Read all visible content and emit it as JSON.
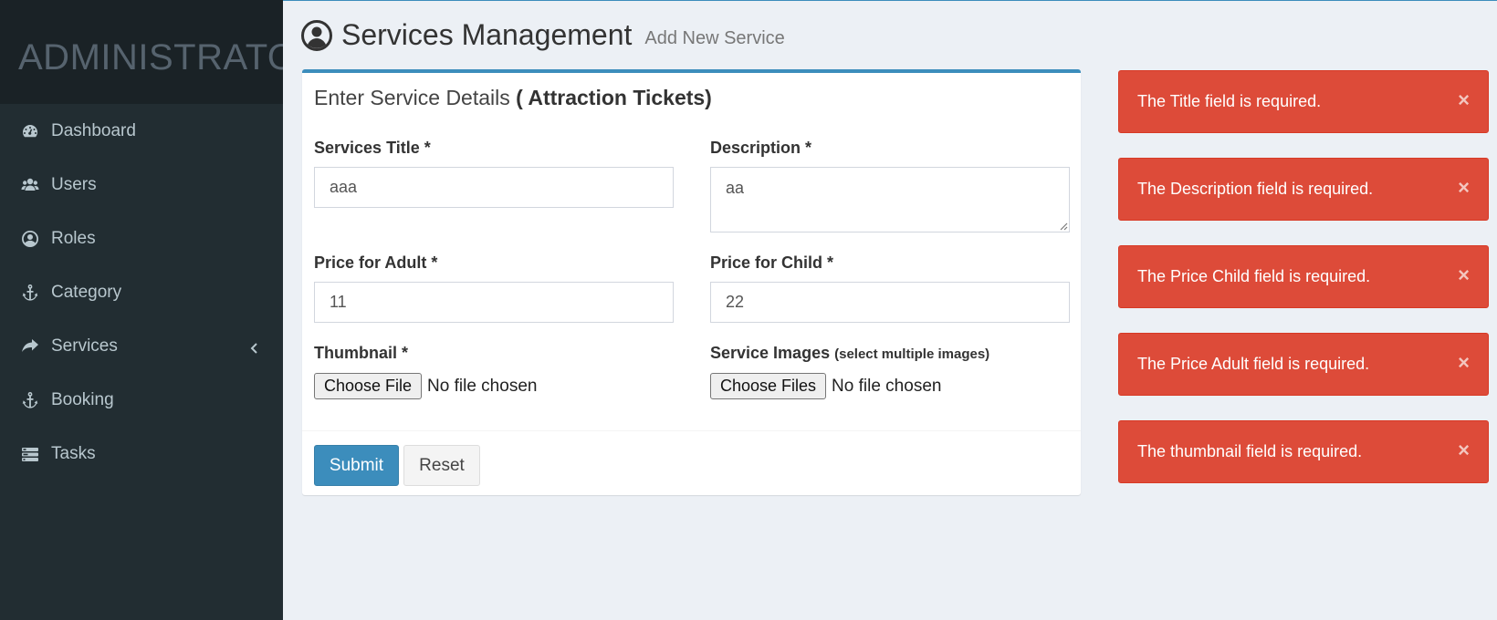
{
  "sidebar": {
    "logo_text": "ADMINISTRATOR",
    "items": [
      {
        "label": "Dashboard",
        "icon": "dashboard-icon"
      },
      {
        "label": "Users",
        "icon": "users-icon"
      },
      {
        "label": "Roles",
        "icon": "user-circle-icon"
      },
      {
        "label": "Category",
        "icon": "anchor-icon"
      },
      {
        "label": "Services",
        "icon": "share-icon",
        "has_submenu": true
      },
      {
        "label": "Booking",
        "icon": "anchor-icon"
      },
      {
        "label": "Tasks",
        "icon": "tasks-icon"
      }
    ]
  },
  "header": {
    "title": "Services Management",
    "subtitle": "Add New Service",
    "icon": "user-circle-icon"
  },
  "form": {
    "box_title_prefix": "Enter Service Details",
    "box_title_bold": "( Attraction Tickets)",
    "title_label": "Services Title *",
    "title_value": "aaa",
    "description_label": "Description *",
    "description_value": "aa",
    "price_adult_label": "Price for Adult *",
    "price_adult_value": "11",
    "price_child_label": "Price for Child *",
    "price_child_value": "22",
    "thumbnail_label": "Thumbnail *",
    "thumbnail_button": "Choose File",
    "thumbnail_status": "No file chosen",
    "images_label": "Service Images",
    "images_hint": "(select multiple images)",
    "images_button": "Choose Files",
    "images_status": "No file chosen",
    "submit_label": "Submit",
    "reset_label": "Reset"
  },
  "alerts": [
    {
      "message": "The Title field is required.",
      "close": "×"
    },
    {
      "message": "The Description field is required.",
      "close": "×"
    },
    {
      "message": "The Price Child field is required.",
      "close": "×"
    },
    {
      "message": "The Price Adult field is required.",
      "close": "×"
    },
    {
      "message": "The thumbnail field is required.",
      "close": "×"
    }
  ],
  "colors": {
    "sidebar_bg": "#222d32",
    "logo_bg": "#1a2226",
    "primary": "#3c8dbc",
    "danger": "#dd4b39",
    "content_bg": "#ecf0f5"
  }
}
